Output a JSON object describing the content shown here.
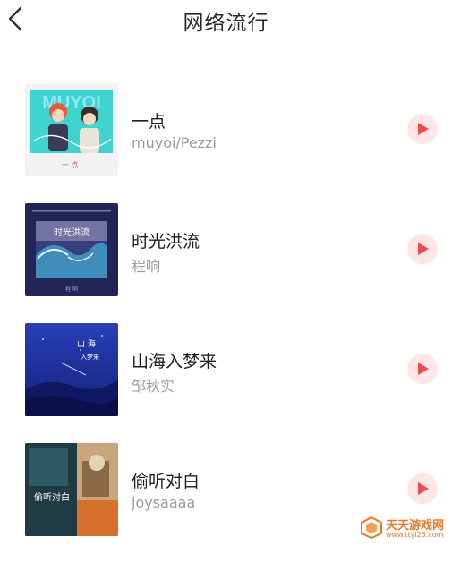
{
  "header": {
    "title": "网络流行",
    "back_icon": "back-arrow-icon"
  },
  "songs": [
    {
      "title": "一点",
      "artist": "muyoi/Pezzi",
      "cover_text": "MUYOI"
    },
    {
      "title": "时光洪流",
      "artist": "程响",
      "cover_text": "时光洪流"
    },
    {
      "title": "山海入梦来",
      "artist": "邹秋实",
      "cover_text": ""
    },
    {
      "title": "偷听对白",
      "artist": "joysaaaa",
      "cover_text": "偷听对白"
    }
  ],
  "play_icon": "play-icon",
  "colors": {
    "play_accent": "#f04b4b",
    "play_background": "#fde6e6",
    "title_text": "#1f1f1f",
    "subtitle_text": "#9b9b9b"
  },
  "watermark": {
    "name": "天天游戏网",
    "url": "www.ttyl23.com"
  }
}
